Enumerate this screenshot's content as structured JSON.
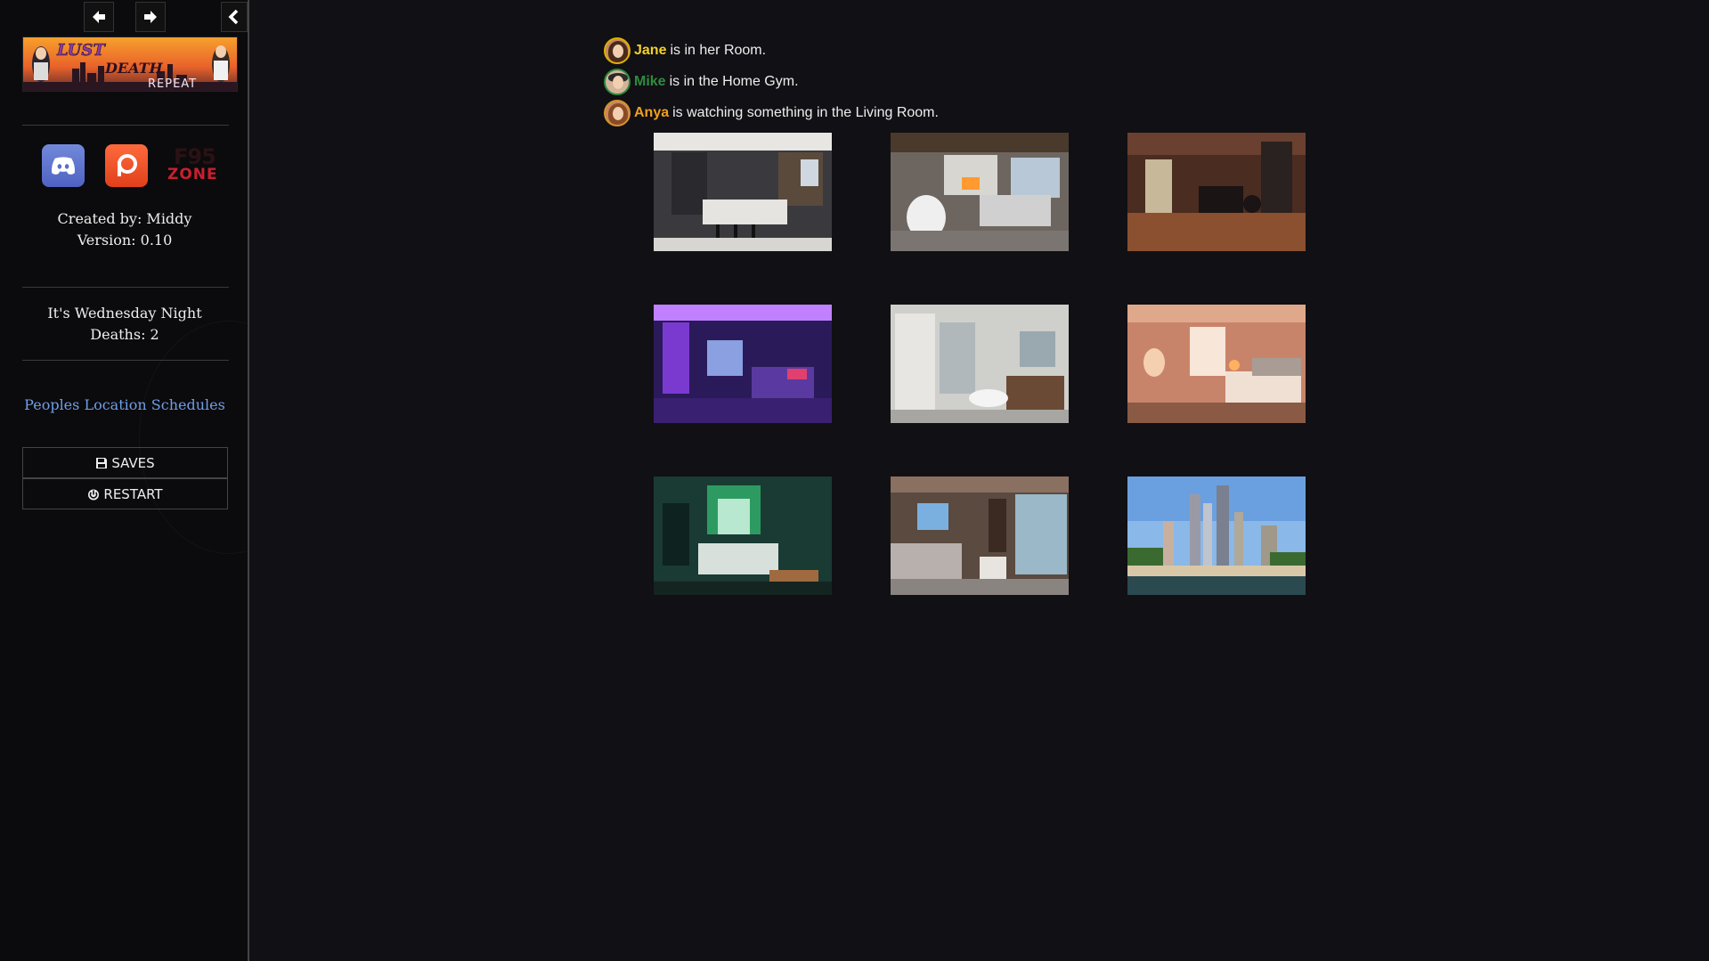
{
  "sidebar": {
    "created_by": "Created by: Middy",
    "version": "Version: 0.10",
    "time_of_day": "It's Wednesday Night",
    "deaths": "Deaths: 2",
    "schedules_link": "Peoples Location Schedules",
    "saves_label": "SAVES",
    "restart_label": "RESTART",
    "banner": {
      "title_1": "LUST",
      "title_2": "DEATH",
      "title_3": "REPEAT"
    },
    "zone_logo": {
      "f95": "F95",
      "zone": "ZONE"
    }
  },
  "locations": [
    {
      "name": "Jane",
      "name_color": "#f2d02c",
      "text": "is in her Room."
    },
    {
      "name": "Mike",
      "name_color": "#2e8b3e",
      "text": "is in the Home Gym."
    },
    {
      "name": "Anya",
      "name_color": "#f0a020",
      "text": "is watching something in the Living Room."
    }
  ],
  "rooms": [
    {
      "id": "kitchen",
      "icon": "kitchen-image"
    },
    {
      "id": "living-room",
      "icon": "living-room-image"
    },
    {
      "id": "home-gym",
      "icon": "home-gym-image"
    },
    {
      "id": "purple-bedroom",
      "icon": "purple-bedroom-image"
    },
    {
      "id": "bathroom",
      "icon": "bathroom-image"
    },
    {
      "id": "peach-bedroom",
      "icon": "peach-bedroom-image"
    },
    {
      "id": "green-bedroom",
      "icon": "green-bedroom-image"
    },
    {
      "id": "master-bedroom",
      "icon": "master-bedroom-image"
    },
    {
      "id": "city",
      "icon": "city-image"
    }
  ],
  "colors": {
    "background": "#111014",
    "sidebar": "#0b0a0c",
    "link": "#6f9fe8"
  }
}
